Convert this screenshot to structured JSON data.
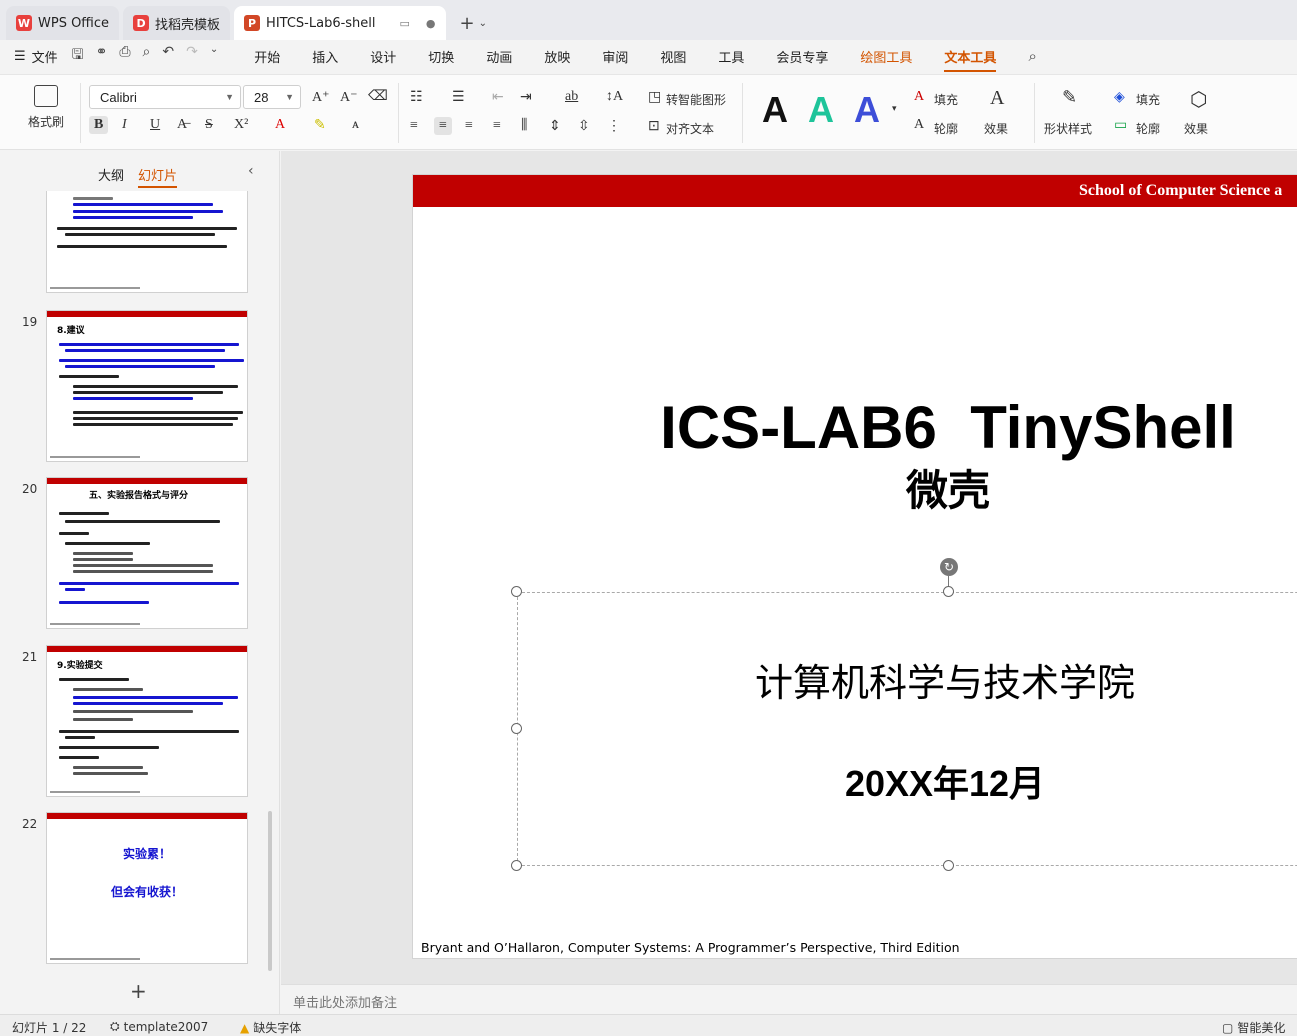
{
  "tabs": [
    {
      "label": "WPS Office",
      "icon": "wps-logo-icon",
      "color": "#e8403d"
    },
    {
      "label": "找稻壳模板",
      "icon": "docer-logo-icon",
      "color": "#e8403d"
    },
    {
      "label": "HITCS-Lab6-shell",
      "icon": "presentation-logo-icon",
      "color": "#d24726",
      "active": true
    }
  ],
  "menubar": {
    "file": "文件",
    "items": [
      "开始",
      "插入",
      "设计",
      "切换",
      "动画",
      "放映",
      "审阅",
      "视图",
      "工具",
      "会员专享"
    ],
    "contextual": [
      "绘图工具",
      "文本工具"
    ],
    "active": "文本工具"
  },
  "ribbon": {
    "format_painter": "格式刷",
    "font_name": "Calibri",
    "font_size": "28",
    "smart_shape": "转智能图形",
    "align_text": "对齐文本",
    "fill": "填充",
    "outline": "轮廓",
    "effect": "效果",
    "shape_style": "形状样式",
    "fill2": "填充",
    "outline2": "轮廓",
    "effect2": "效果",
    "wordart_letter": "A",
    "wordart_colors": [
      "#111111",
      "#1ec49a",
      "#3d4ed8"
    ]
  },
  "left_panel": {
    "tabs": [
      "大纲",
      "幻灯片"
    ],
    "active_tab": "幻灯片",
    "slides": [
      {
        "number": "19",
        "title": "8.建议"
      },
      {
        "number": "20",
        "title": "五、实验报告格式与评分"
      },
      {
        "number": "21",
        "title": "9.实验提交"
      },
      {
        "number": "22",
        "lines": [
          "实验累！",
          "但会有收获！"
        ]
      }
    ]
  },
  "slide": {
    "header": "School of Computer Science a",
    "title": "ICS-LAB6  TinyShell",
    "subtitle": "微壳",
    "school": "计算机科学与技术学院",
    "date": "20XX年12月",
    "footer": "Bryant and O’Hallaron, Computer Systems: A Programmer’s Perspective, Third Edition",
    "header_color": "#c00000"
  },
  "notes_placeholder": "单击此处添加备注",
  "statusbar": {
    "slide_index": "幻灯片 1 / 22",
    "template": "template2007",
    "missing_font": "缺失字体",
    "beautify": "智能美化"
  }
}
